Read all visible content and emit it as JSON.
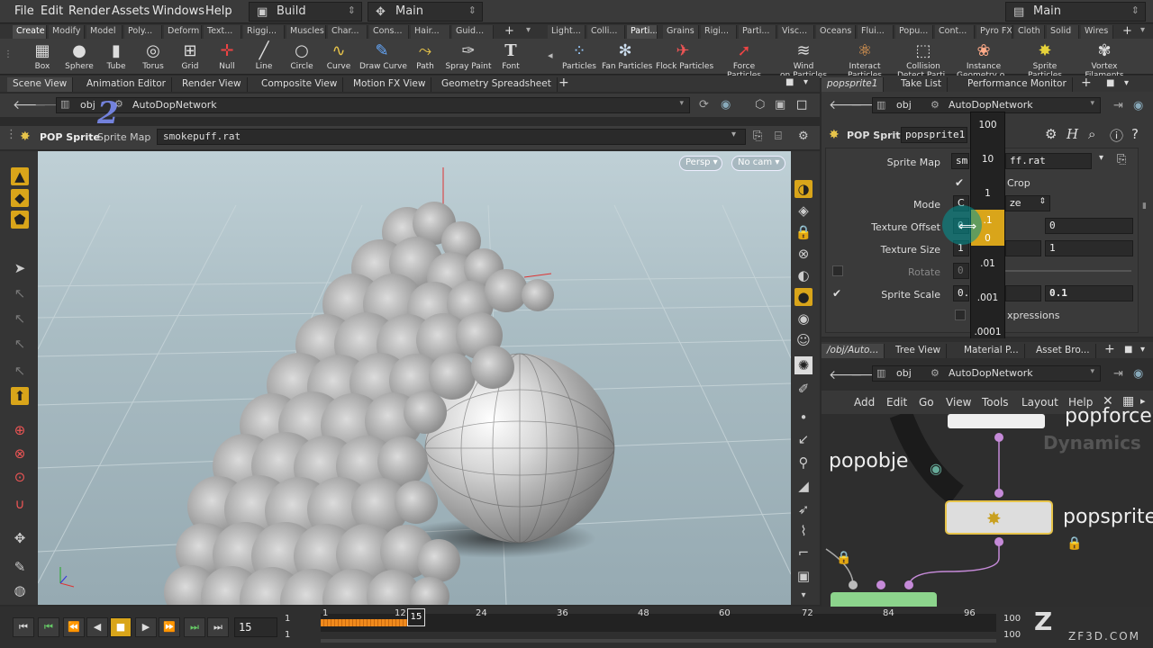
{
  "menubar": {
    "items": [
      "File",
      "Edit",
      "Render",
      "Assets",
      "Windows",
      "Help"
    ],
    "desktop": "Build",
    "desktop2": "Main",
    "desktop3": "Main"
  },
  "shelf_tabs_left": [
    "Create",
    "Modify",
    "Model",
    "Poly...",
    "Deform",
    "Text...",
    "Riggi...",
    "Muscles",
    "Char...",
    "Cons...",
    "Hair...",
    "Guid..."
  ],
  "shelf_tabs_right": [
    "Light...",
    "Colli...",
    "Parti...",
    "Grains",
    "Rigi...",
    "Parti...",
    "Visc...",
    "Oceans",
    "Flui...",
    "Popu...",
    "Cont...",
    "Pyro FX",
    "Cloth",
    "Solid",
    "Wires"
  ],
  "tools_left": [
    {
      "label": "Box",
      "icon": "box-icon"
    },
    {
      "label": "Sphere",
      "icon": "sphere-icon"
    },
    {
      "label": "Tube",
      "icon": "tube-icon"
    },
    {
      "label": "Torus",
      "icon": "torus-icon"
    },
    {
      "label": "Grid",
      "icon": "grid-icon"
    },
    {
      "label": "Null",
      "icon": "null-icon"
    },
    {
      "label": "Line",
      "icon": "line-icon"
    },
    {
      "label": "Circle",
      "icon": "circle-icon"
    },
    {
      "label": "Curve",
      "icon": "curve-icon"
    },
    {
      "label": "Draw Curve",
      "icon": "draw-curve-icon"
    },
    {
      "label": "Path",
      "icon": "path-icon"
    },
    {
      "label": "Spray Paint",
      "icon": "spray-paint-icon"
    },
    {
      "label": "Font",
      "icon": "font-icon"
    }
  ],
  "tools_right": [
    {
      "label": "Particles",
      "label2": "",
      "icon": "particles-icon"
    },
    {
      "label": "Fan Particles",
      "label2": "",
      "icon": "fan-particles-icon"
    },
    {
      "label": "Flock Particles",
      "label2": "",
      "icon": "flock-particles-icon"
    },
    {
      "label": "Force",
      "label2": "Particles",
      "icon": "force-icon"
    },
    {
      "label": "Wind",
      "label2": "on Particles",
      "icon": "wind-icon"
    },
    {
      "label": "Interact",
      "label2": "Particles",
      "icon": "interact-icon"
    },
    {
      "label": "Collision",
      "label2": "Detect Parti...",
      "icon": "collision-icon"
    },
    {
      "label": "Instance",
      "label2": "Geometry o...",
      "icon": "instance-icon"
    },
    {
      "label": "Sprite",
      "label2": "Particles",
      "icon": "sprite-icon"
    },
    {
      "label": "Vortex",
      "label2": "Filaments",
      "icon": "vortex-icon"
    }
  ],
  "pane_tabs": [
    "Scene View",
    "Animation Editor",
    "Render View",
    "Composite View",
    "Motion FX View",
    "Geometry Spreadsheet"
  ],
  "viewer": {
    "path_obj": "obj",
    "path_network": "AutoDopNetwork",
    "node_type": "POP Sprite",
    "param_label": "Sprite Map",
    "param_value": "smokepuff.rat",
    "persp": "Persp",
    "cam": "No cam"
  },
  "right_tabs": [
    "popsprite1",
    "Take List",
    "Performance Monitor"
  ],
  "params": {
    "path_obj": "obj",
    "path_network": "AutoDopNetwork",
    "node_type": "POP Sprite",
    "node_name": "popsprite1",
    "sprite_map_label": "Sprite Map",
    "sprite_map_value": "sm",
    "sprite_map_value2": "ff.rat",
    "crop_label": "Crop",
    "mode_label": "Mode",
    "mode_value": "C",
    "mode_value2": "ze",
    "tex_offset_label": "Texture Offset",
    "tex_offset_x": "0",
    "tex_offset_z": "0",
    "tex_size_label": "Texture Size",
    "tex_size_x": "1",
    "tex_size_z": "1",
    "rotate_label": "Rotate",
    "rotate_value": "0",
    "scale_label": "Sprite Scale",
    "scale_x": "0.",
    "scale_z": "0.1",
    "expr_label": "xpressions"
  },
  "ladder": [
    "100",
    "10",
    "1",
    ".1",
    "0",
    ".01",
    ".001",
    ".0001"
  ],
  "network_tabs": [
    "/obj/Auto...",
    "Tree View",
    "Material P...",
    "Asset Bro..."
  ],
  "network": {
    "path_obj": "obj",
    "path_network": "AutoDopNetwork",
    "menu": [
      "Add",
      "Edit",
      "Go",
      "View",
      "Tools",
      "Layout",
      "Help"
    ],
    "node1": "popforce",
    "node2": "popobje",
    "node3": "popsprite",
    "context": "Dynamics"
  },
  "timeline": {
    "frame": "15",
    "start": "1",
    "start2": "1",
    "end": "100",
    "end2": "100",
    "current": "15",
    "ticks": [
      "1",
      "12",
      "24",
      "36",
      "48",
      "60",
      "72",
      "84",
      "96"
    ]
  },
  "watermark": "ZF3D.COM",
  "overlay_digit": "2",
  "colors": {
    "accent": "#d9a51a",
    "smoke": "#c8c8c8"
  }
}
